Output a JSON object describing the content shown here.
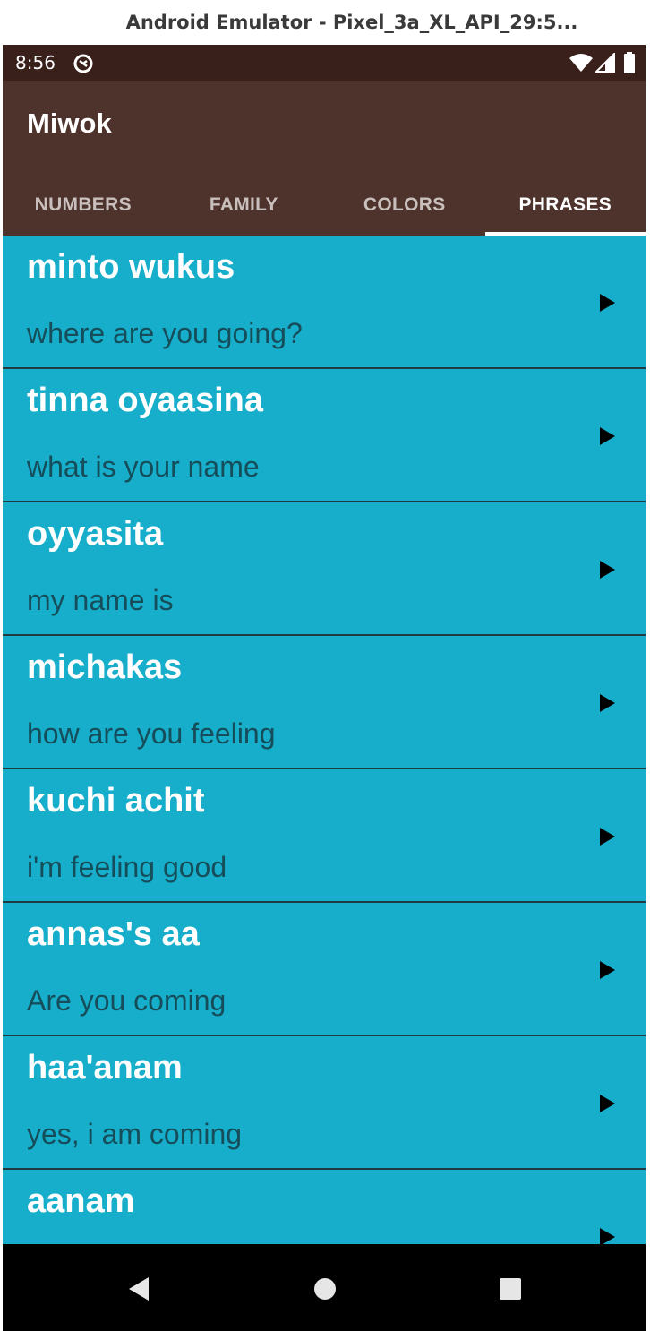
{
  "window": {
    "title": "Android Emulator - Pixel_3a_XL_API_29:5..."
  },
  "status_bar": {
    "time": "8:56",
    "icons": [
      "app-notification-icon",
      "wifi-icon",
      "signal-icon",
      "battery-icon"
    ]
  },
  "app_bar": {
    "title": "Miwok"
  },
  "tabs": [
    {
      "label": "NUMBERS",
      "active": false
    },
    {
      "label": "FAMILY",
      "active": false
    },
    {
      "label": "COLORS",
      "active": false
    },
    {
      "label": "PHRASES",
      "active": true
    }
  ],
  "phrases": [
    {
      "miwok": "minto wukus",
      "english": "where are you going?"
    },
    {
      "miwok": "tinna oyaasina",
      "english": "what is your name"
    },
    {
      "miwok": "oyyasita",
      "english": "my name is"
    },
    {
      "miwok": "michakas",
      "english": "how are you feeling"
    },
    {
      "miwok": "kuchi achit",
      "english": "i'm feeling good"
    },
    {
      "miwok": "annas's aa",
      "english": "Are you coming"
    },
    {
      "miwok": "haa'anam",
      "english": "yes, i am coming"
    },
    {
      "miwok": "aanam",
      "english": ""
    }
  ],
  "colors": {
    "status_bar": "#3a201b",
    "app_bar": "#4e322c",
    "list_background": "#17aecb",
    "miwok_text": "#ffffff",
    "english_text": "#154e5a"
  },
  "nav_bar": {
    "icons": [
      "back-icon",
      "home-icon",
      "recents-icon"
    ]
  }
}
